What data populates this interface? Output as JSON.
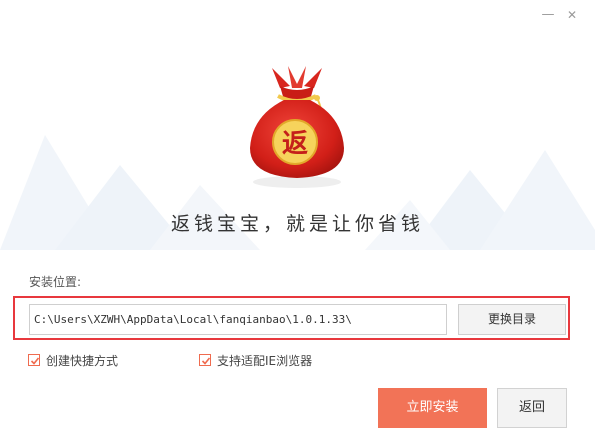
{
  "window": {
    "minimize_glyph": "—",
    "close_glyph": "✕"
  },
  "logo": {
    "character": "返",
    "icon": "money-bag-icon"
  },
  "slogan": "返钱宝宝，就是让你省钱",
  "install": {
    "location_label": "安装位置:",
    "path_value": "C:\\Users\\XZWH\\AppData\\Local\\fanqianbao\\1.0.1.33\\",
    "browse_label": "更换目录"
  },
  "options": [
    {
      "label": "创建快捷方式",
      "checked": true
    },
    {
      "label": "支持适配IE浏览器",
      "checked": true
    }
  ],
  "actions": {
    "install_label": "立即安装",
    "back_label": "返回"
  },
  "colors": {
    "accent": "#f27357",
    "highlight_border": "#e8383d",
    "bag_red": "#d9231c",
    "gold": "#f2c94c"
  }
}
